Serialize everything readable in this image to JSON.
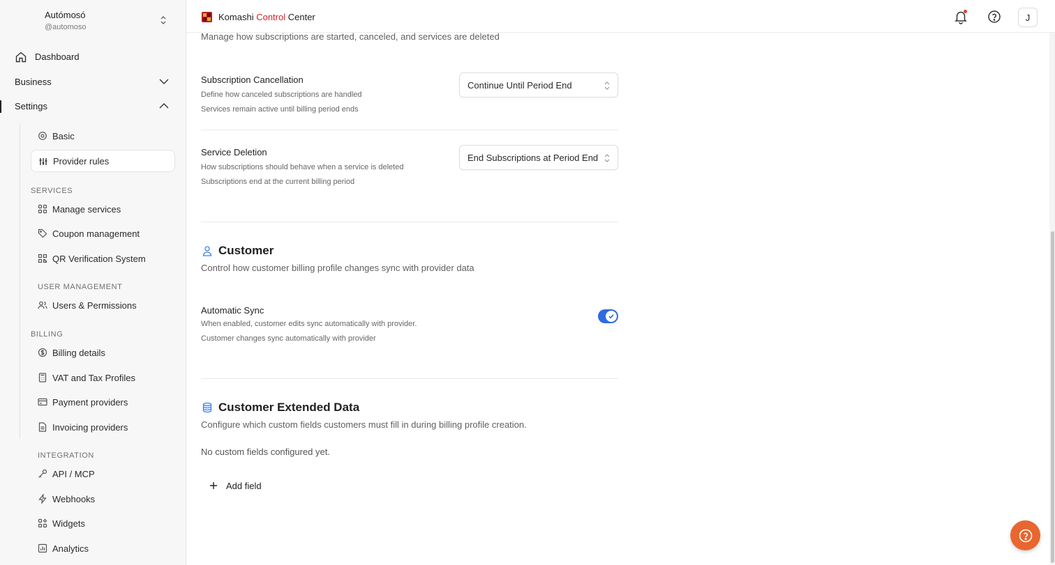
{
  "workspace": {
    "name": "Autómosó",
    "handle": "@automoso"
  },
  "nav": {
    "dashboard": "Dashboard",
    "business": "Business",
    "settings": "Settings",
    "settings_items": [
      {
        "label": "Basic",
        "icon": "gear-icon"
      },
      {
        "label": "Provider rules",
        "icon": "sliders-icon",
        "active": true
      }
    ],
    "groups": {
      "services": "SERVICES",
      "user_management": "USER MANAGEMENT",
      "billing": "BILLING",
      "integration": "INTEGRATION"
    },
    "services_items": [
      "Manage services",
      "Coupon management",
      "QR Verification System"
    ],
    "user_items": [
      "Users & Permissions"
    ],
    "billing_items": [
      "Billing details",
      "VAT and Tax Profiles",
      "Payment providers",
      "Invoicing providers"
    ],
    "integration_items": [
      "API / MCP",
      "Webhooks",
      "Widgets",
      "Analytics"
    ]
  },
  "header": {
    "brand_1": "Komashi ",
    "brand_2": "Control",
    "brand_3": " Center",
    "avatar": "J"
  },
  "subscriptions": {
    "description": "Manage how subscriptions are started, canceled, and services are deleted",
    "cancellation": {
      "title": "Subscription Cancellation",
      "desc": "Define how canceled subscriptions are handled",
      "note": "Services remain active until billing period ends",
      "value": "Continue Until Period End"
    },
    "deletion": {
      "title": "Service Deletion",
      "desc": "How subscriptions should behave when a service is deleted",
      "note": "Subscriptions end at the current billing period",
      "value": "End Subscriptions at Period End"
    }
  },
  "customer": {
    "title": "Customer",
    "description": "Control how customer billing profile changes sync with provider data",
    "sync": {
      "title": "Automatic Sync",
      "desc": "When enabled, customer edits sync automatically with provider.",
      "note": "Customer changes sync automatically with provider",
      "enabled": true
    }
  },
  "extended": {
    "title": "Customer Extended Data",
    "description": "Configure which custom fields customers must fill in during billing profile creation.",
    "empty": "No custom fields configured yet.",
    "add_label": "Add field"
  },
  "colors": {
    "accent": "#2f6bde",
    "brand_red": "#d8202b",
    "fab": "#e8662f"
  }
}
